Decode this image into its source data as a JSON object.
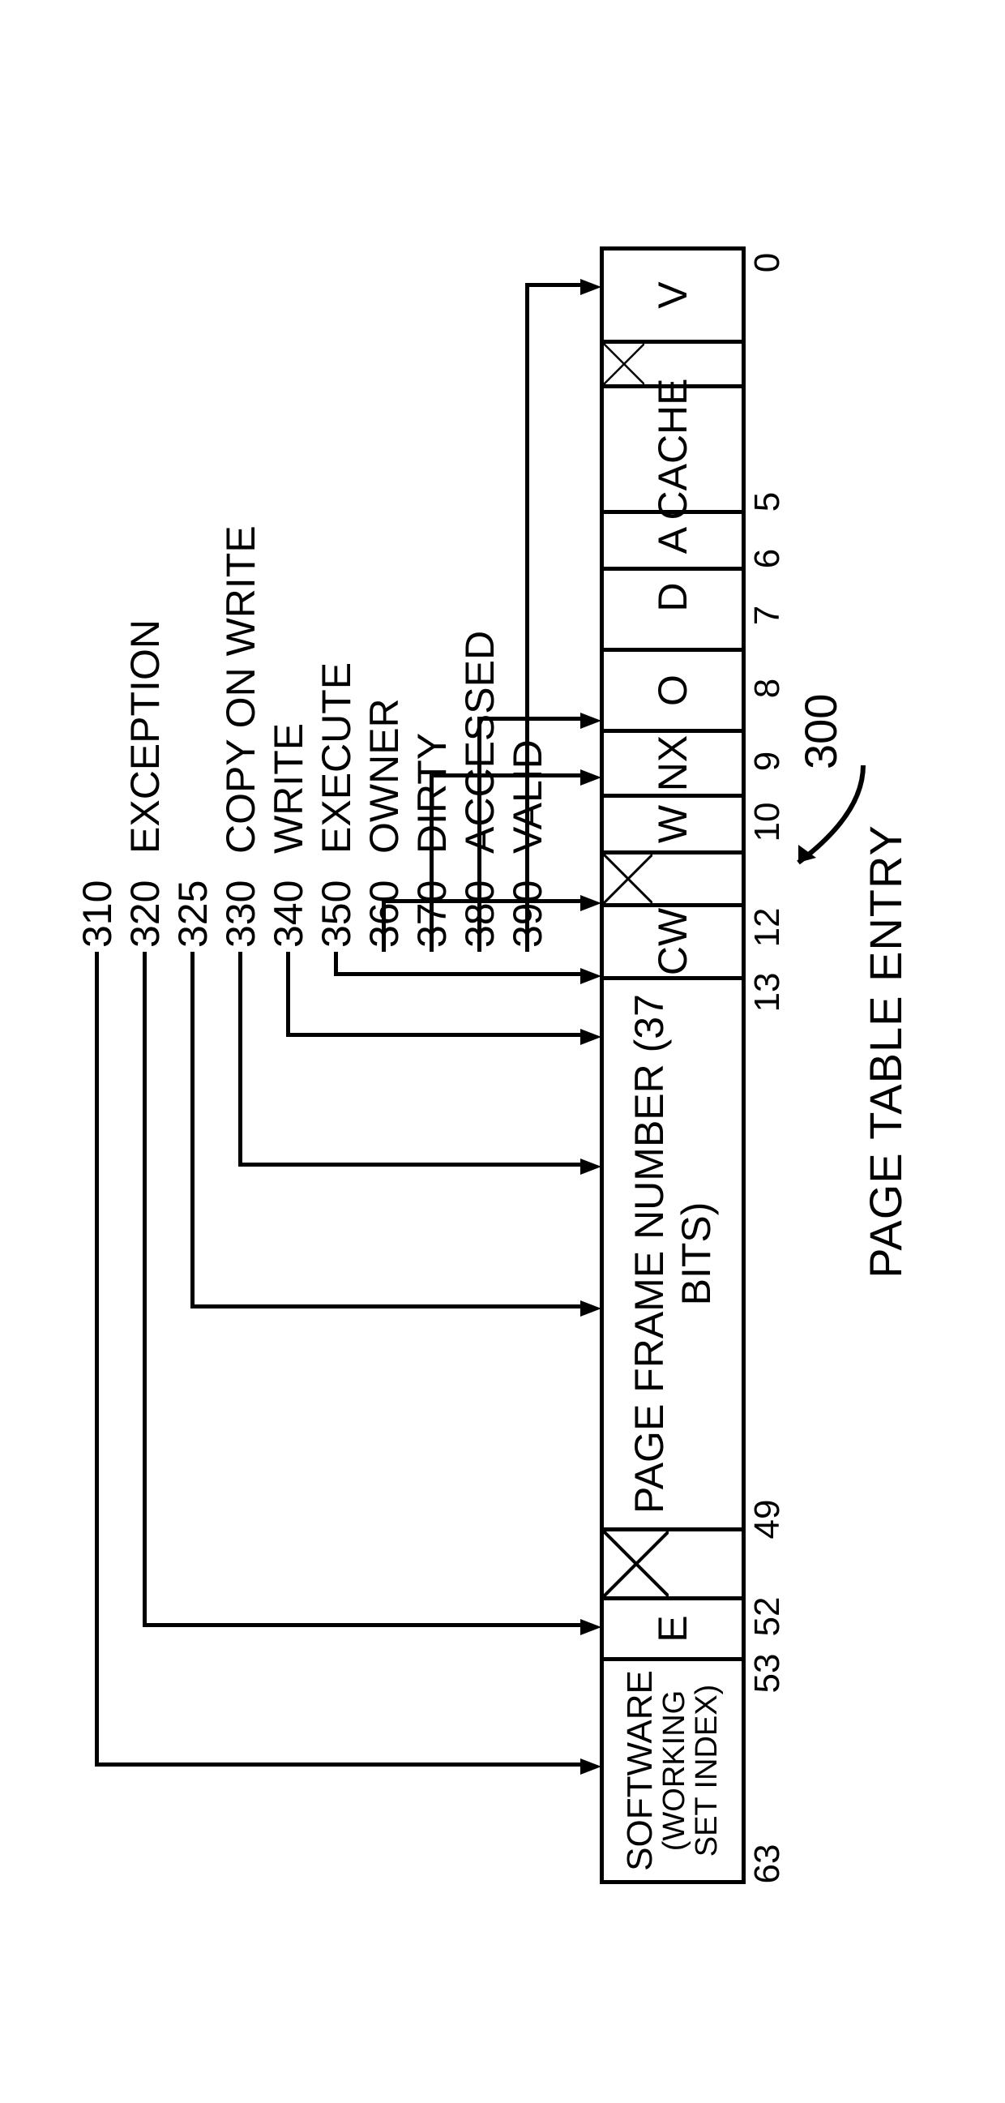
{
  "caption": "PAGE TABLE ENTRY",
  "figure_ref": "300",
  "segments": {
    "software": "SOFTWARE",
    "software_sub": "(WORKING SET INDEX)",
    "e": "E",
    "reserved": "",
    "pfn": "PAGE FRAME NUMBER (37 BITS)",
    "cw": "CW",
    "res2": "",
    "w": "W",
    "nx": "NX",
    "o": "O",
    "gap": "",
    "d": "D",
    "a": "A",
    "cache": "CACHE",
    "res3": "",
    "v": "V"
  },
  "bit_positions": {
    "b63": "63",
    "b53": "53",
    "b52": "52",
    "b49": "49",
    "b13": "13",
    "b12": "12",
    "b10": "10",
    "b9": "9",
    "b8": "8",
    "b7": "7",
    "b6": "6",
    "b5": "5",
    "b0": "0"
  },
  "legend": {
    "r310": {
      "num": "310",
      "name": ""
    },
    "r320": {
      "num": "320",
      "name": "EXCEPTION"
    },
    "r325": {
      "num": "325",
      "name": ""
    },
    "r330": {
      "num": "330",
      "name": "COPY ON WRITE"
    },
    "r340": {
      "num": "340",
      "name": "WRITE"
    },
    "r350": {
      "num": "350",
      "name": "EXECUTE"
    },
    "r360": {
      "num": "360",
      "name": "OWNER"
    },
    "r370": {
      "num": "370",
      "name": "DIRTY"
    },
    "r380": {
      "num": "380",
      "name": "ACCESSED"
    },
    "r390": {
      "num": "390",
      "name": "VALID"
    }
  }
}
